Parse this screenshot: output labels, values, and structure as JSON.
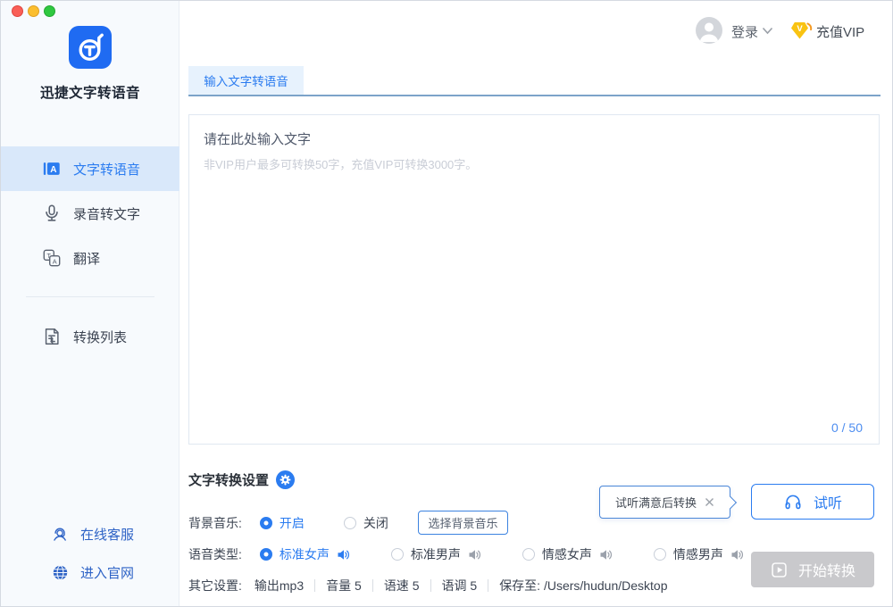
{
  "app": {
    "name": "迅捷文字转语音"
  },
  "sidebar": {
    "nav": [
      {
        "label": "文字转语音",
        "active": true
      },
      {
        "label": "录音转文字",
        "active": false
      },
      {
        "label": "翻译",
        "active": false
      },
      {
        "label": "转换列表",
        "active": false
      }
    ],
    "footer": [
      {
        "label": "在线客服"
      },
      {
        "label": "进入官网"
      }
    ]
  },
  "header": {
    "login_label": "登录",
    "vip_label": "充值VIP"
  },
  "tabs": [
    {
      "label": "输入文字转语音",
      "active": true
    }
  ],
  "editor": {
    "placeholder_title": "请在此处输入文字",
    "placeholder_hint": "非VIP用户最多可转换50字，充值VIP可转换3000字。",
    "char_count": "0 / 50"
  },
  "settings": {
    "title": "文字转换设置",
    "bg_music": {
      "label": "背景音乐:",
      "options": [
        "开启",
        "关闭"
      ],
      "selected": "开启",
      "choose_button": "选择背景音乐"
    },
    "voice_type": {
      "label": "语音类型:",
      "options": [
        "标准女声",
        "标准男声",
        "情感女声",
        "情感男声"
      ],
      "selected": "标准女声"
    },
    "other": {
      "label": "其它设置:",
      "items": [
        "输出mp3",
        "音量 5",
        "语速 5",
        "语调 5",
        "保存至: /Users/hudun/Desktop"
      ]
    }
  },
  "actions": {
    "tooltip": "试听满意后转换",
    "preview_button": "试听",
    "convert_button": "开始转换"
  },
  "colors": {
    "accent": "#2b7cf0",
    "active_nav_bg": "#d9e8fa",
    "vip_gold": "#f9c312",
    "vip_swoosh": "#f59a23",
    "disabled_button": "#c9c9cc",
    "counter_blue": "#4d8df0",
    "tab_bg": "#e7f2fd"
  }
}
